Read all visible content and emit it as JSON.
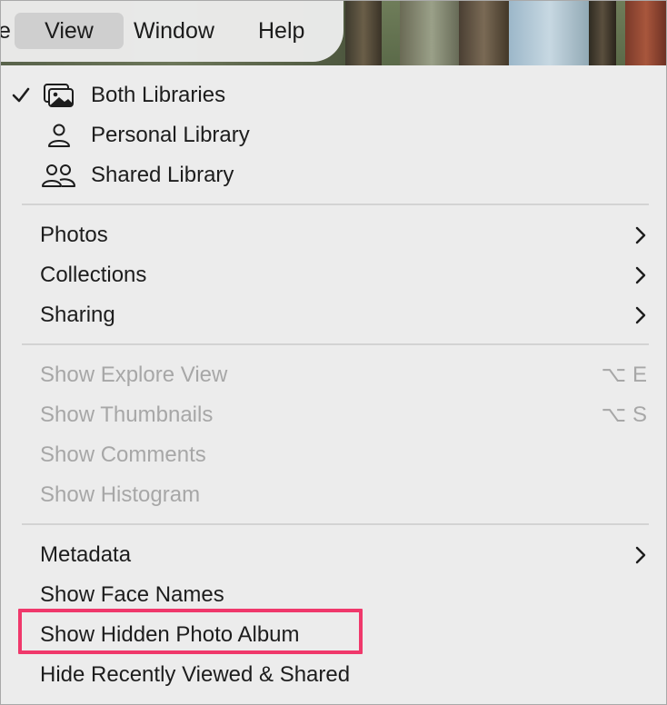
{
  "menubar": {
    "partial_item": "e",
    "items": [
      {
        "label": "View"
      },
      {
        "label": "Window"
      },
      {
        "label": "Help"
      }
    ]
  },
  "library_section": [
    {
      "label": "Both Libraries",
      "icon": "photo-library-icon",
      "checked": true
    },
    {
      "label": "Personal Library",
      "icon": "person-icon",
      "checked": false
    },
    {
      "label": "Shared Library",
      "icon": "two-people-icon",
      "checked": false
    }
  ],
  "browse_section": [
    {
      "label": "Photos",
      "submenu": true
    },
    {
      "label": "Collections",
      "submenu": true
    },
    {
      "label": "Sharing",
      "submenu": true
    }
  ],
  "show_section": [
    {
      "label": "Show Explore View",
      "shortcut": "⌥ E",
      "enabled": false
    },
    {
      "label": "Show Thumbnails",
      "shortcut": "⌥ S",
      "enabled": false
    },
    {
      "label": "Show Comments",
      "enabled": false
    },
    {
      "label": "Show Histogram",
      "enabled": false
    }
  ],
  "misc_section": [
    {
      "label": "Metadata",
      "submenu": true
    },
    {
      "label": "Show Face Names"
    },
    {
      "label": "Show Hidden Photo Album",
      "highlighted": true
    },
    {
      "label": "Hide Recently Viewed & Shared"
    }
  ],
  "colors": {
    "highlight_border": "#f0386b",
    "disabled_text": "#a7a7a7",
    "menu_background": "#ececec"
  }
}
